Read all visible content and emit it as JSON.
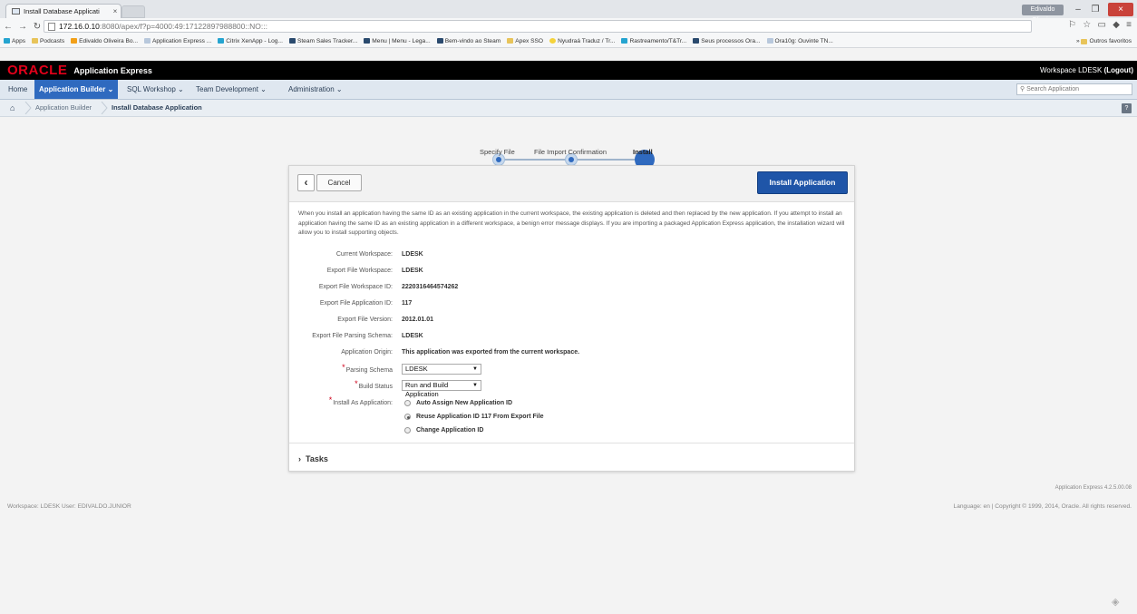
{
  "browser": {
    "tab_title": "Install Database Applicati",
    "user_badge": "Edivaldo Oliveira",
    "url_host": "172.16.0.10",
    "url_path": ":8080/apex/f?p=4000:49:17122897988800::NO:::",
    "bookmarks": [
      "Apps",
      "Podcasts",
      "Edivaldo Oliveira Bo...",
      "Application Express ...",
      "Citrix XenApp - Log...",
      "Steam Sales Tracker...",
      "Menu | Menu - Lega...",
      "Bem-vindo ao Steam",
      "Apex SSO",
      "Nyudraá Traduz / Tr...",
      "Rastreamento/T&Tr...",
      "Seus processos Ora...",
      "Ora10g: Ouvinte TN..."
    ],
    "bookmarks_other": "Outros favoritos"
  },
  "header": {
    "brand": "ORACLE",
    "app_name": "Application Express",
    "workspace_label": "Workspace LDESK",
    "logout": "(Logout)"
  },
  "menu": {
    "home": "Home",
    "items": [
      "Application Builder",
      "SQL Workshop",
      "Team Development",
      "Administration"
    ],
    "search_placeholder": "Search Application"
  },
  "breadcrumb": {
    "items": [
      "Application Builder",
      "Install Database Application"
    ]
  },
  "wizard": {
    "steps": [
      "Specify File",
      "File Import Confirmation",
      "Install"
    ]
  },
  "card": {
    "cancel": "Cancel",
    "install": "Install Application",
    "info": "When you install an application having the same ID as an existing application in the current workspace, the existing application is deleted and then replaced by the new application. If you attempt to install an application having the same ID as an existing application in a different workspace, a benign error message displays. If you are importing a packaged Application Express application, the installation wizard will allow you to install supporting objects.",
    "fields": [
      {
        "label": "Current Workspace:",
        "value": "LDESK"
      },
      {
        "label": "Export File Workspace:",
        "value": "LDESK"
      },
      {
        "label": "Export File Workspace ID:",
        "value": "2220316464574262"
      },
      {
        "label": "Export File Application ID:",
        "value": "117"
      },
      {
        "label": "Export File Version:",
        "value": "2012.01.01"
      },
      {
        "label": "Export File Parsing Schema:",
        "value": "LDESK"
      },
      {
        "label": "Application Origin:",
        "value": "This application was exported from the current workspace."
      }
    ],
    "parsing_schema_label": "Parsing Schema",
    "parsing_schema_value": "LDESK",
    "build_status_label": "Build Status",
    "build_status_value": "Run and Build Application",
    "install_as_label": "Install As Application:",
    "install_options": [
      {
        "label": "Auto Assign New Application ID",
        "selected": false
      },
      {
        "label": "Reuse Application ID 117 From Export File",
        "selected": true
      },
      {
        "label": "Change Application ID",
        "selected": false
      }
    ],
    "tasks": "Tasks"
  },
  "footer": {
    "version": "Application Express 4.2.5.00.08",
    "left": "Workspace: LDESK User: EDIVALDO.JUNIOR",
    "right": "Language: en | Copyright © 1999, 2014, Oracle. All rights reserved."
  }
}
